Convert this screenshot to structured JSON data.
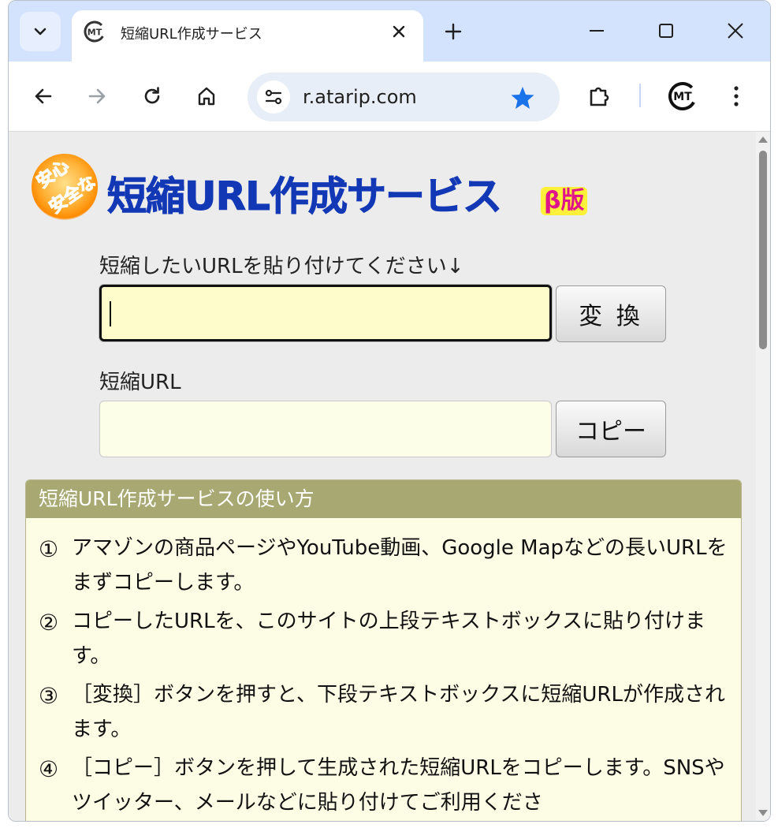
{
  "browser": {
    "tab": {
      "title": "短縮URL作成サービス",
      "favicon": "MT"
    },
    "address": {
      "url": "r.atarip.com"
    },
    "profile": "MT",
    "colors": {
      "tabstrip": "#d3e3fd",
      "omnibox": "#e8eef7",
      "star": "#1a73e8"
    }
  },
  "page": {
    "logo": {
      "badge_line1": "安心",
      "badge_line2": "安全な",
      "title": "短縮URL作成サービス",
      "beta": "β版"
    },
    "form": {
      "input_label": "短縮したいURLを貼り付けてください↓",
      "input_value": "",
      "convert_button": "変 換",
      "output_label": "短縮URL",
      "output_value": "",
      "copy_button": "コピー"
    },
    "howto": {
      "heading": "短縮URL作成サービスの使い方",
      "steps": [
        {
          "num": "①",
          "text": "アマゾンの商品ページやYouTube動画、Google Mapなどの長いURLをまずコピーします。"
        },
        {
          "num": "②",
          "text": "コピーしたURLを、このサイトの上段テキストボックスに貼り付けます。"
        },
        {
          "num": "③",
          "text": "［変換］ボタンを押すと、下段テキストボックスに短縮URLが作成されます。"
        },
        {
          "num": "④",
          "text": "［コピー］ボタンを押して生成された短縮URLをコピーします。SNSやツイッター、メールなどに貼り付けてご利用くださ"
        }
      ]
    },
    "colors": {
      "logo_title": "#1238b5",
      "howto_head": "#a8a872",
      "input_bg": "#fffccc"
    }
  }
}
